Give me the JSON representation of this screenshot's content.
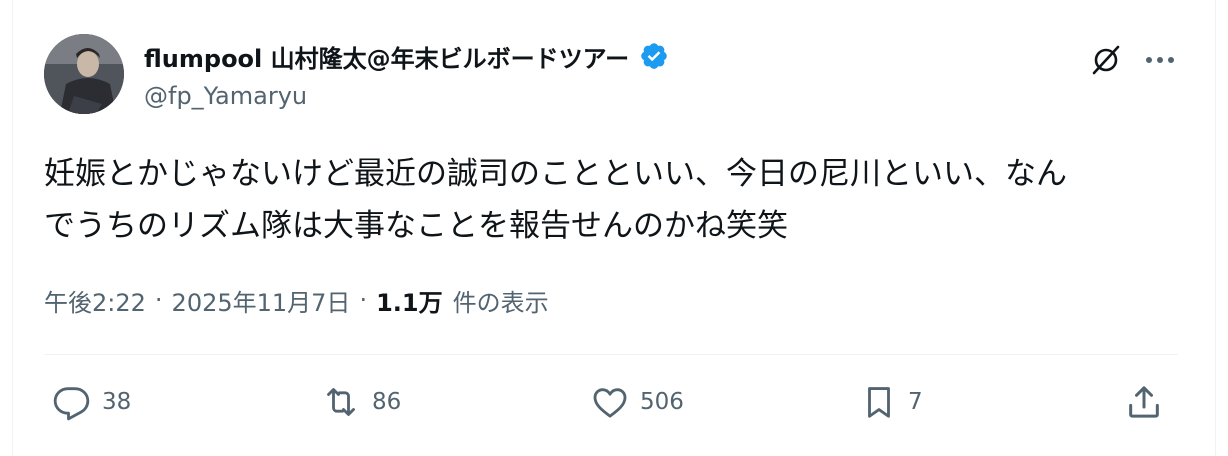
{
  "author": {
    "display_name": "flumpool 山村隆太@年末ビルボードツアー",
    "handle": "@fp_Yamaryu",
    "verified_badge_icon": "verified-badge-icon",
    "verified_color": "#1d9bf0"
  },
  "post": {
    "text": "妊娠とかじゃないけど最近の誠司のことといい、今日の尼川といい、なん\nでうちのリズム隊は大事なことを報告せんのかね笑笑"
  },
  "meta": {
    "time": "午後2:22",
    "separator": "·",
    "date": "2025年11月7日",
    "views_count": "1.1万",
    "views_label": "件の表示"
  },
  "actions": {
    "reply_count": "38",
    "retweet_count": "86",
    "like_count": "506",
    "bookmark_count": "7"
  },
  "icons": {
    "grok": "grok-icon",
    "more": "more-dots-icon",
    "reply": "reply-icon",
    "retweet": "retweet-icon",
    "like": "heart-icon",
    "bookmark": "bookmark-icon",
    "share": "share-icon"
  },
  "colors": {
    "text_primary": "#0f1419",
    "text_secondary": "#536471",
    "divider": "#eff3f4"
  }
}
